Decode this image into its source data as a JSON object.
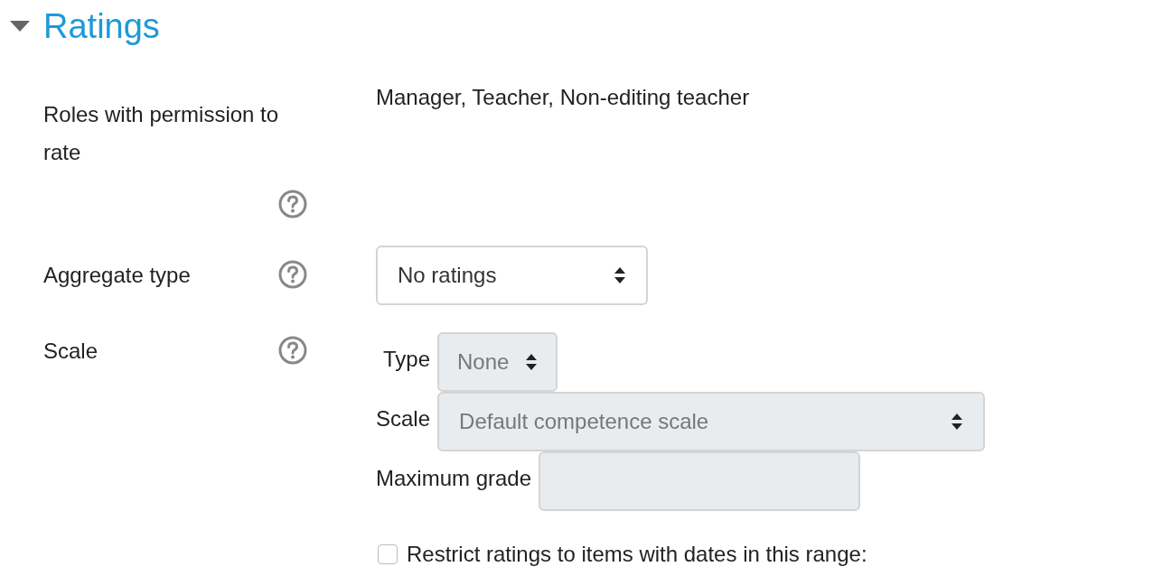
{
  "section": {
    "title": "Ratings",
    "expanded": true
  },
  "fields": [
    {
      "kind": "static",
      "label": "Roles with permission to rate",
      "value": "Manager, Teacher, Non-editing teacher"
    },
    {
      "kind": "select",
      "label": "Aggregate type",
      "value": "No ratings",
      "disabled": false
    },
    {
      "kind": "group",
      "label": "Scale",
      "parts": [
        {
          "kind": "select",
          "label": "Type",
          "value": "None",
          "disabled": true
        },
        {
          "kind": "select",
          "label": "Scale",
          "value": "Default competence scale",
          "disabled": true
        },
        {
          "kind": "text",
          "label": "Maximum grade",
          "disabled": true
        }
      ],
      "checkbox": {
        "label": "Restrict ratings to items with dates in this range:",
        "checked": false
      }
    }
  ]
}
